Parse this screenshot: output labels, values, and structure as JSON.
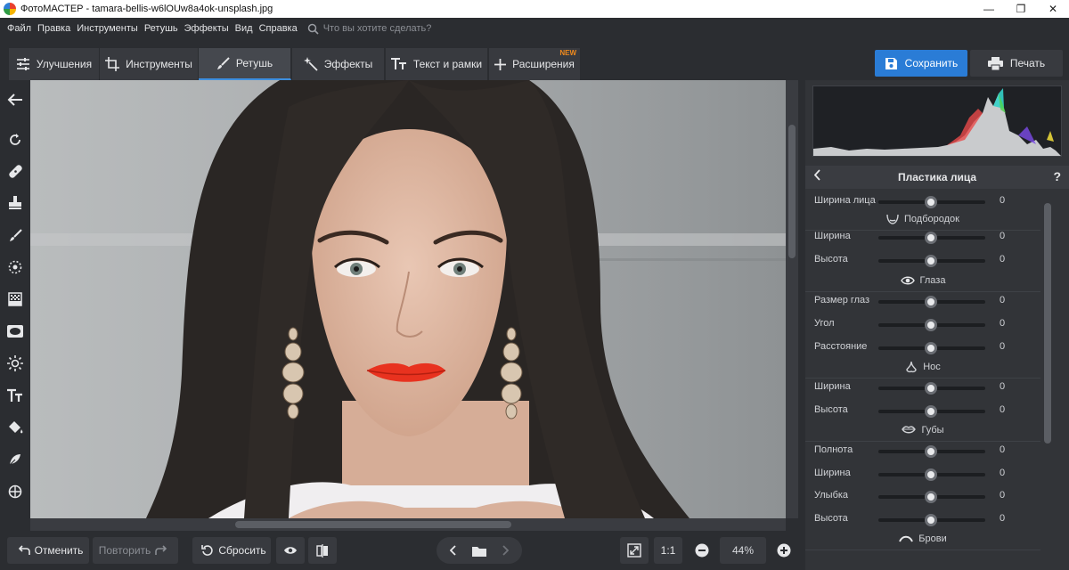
{
  "window": {
    "title": "ФотоМАСТЕР - tamara-bellis-w6lOUw8a4ok-unsplash.jpg",
    "controls": [
      "—",
      "❐",
      "✕"
    ]
  },
  "menu": {
    "items": [
      "Файл",
      "Правка",
      "Инструменты",
      "Ретушь",
      "Эффекты",
      "Вид",
      "Справка"
    ],
    "search_placeholder": "Что вы хотите сделать?"
  },
  "tabs": [
    {
      "label": "Улучшения",
      "icon": "sliders-icon",
      "active": false
    },
    {
      "label": "Инструменты",
      "icon": "crop-icon",
      "active": false
    },
    {
      "label": "Ретушь",
      "icon": "brush-icon",
      "active": true
    },
    {
      "label": "Эффекты",
      "icon": "sparkle-icon",
      "active": false
    },
    {
      "label": "Текст и рамки",
      "icon": "text-icon",
      "active": false
    },
    {
      "label": "Расширения",
      "icon": "plus-icon",
      "active": false,
      "badge": "NEW"
    }
  ],
  "actions": {
    "save": "Сохранить",
    "print": "Печать"
  },
  "colors": {
    "accent": "#2a7cd6",
    "badge": "#f08a1d",
    "lips": "#e8321f"
  },
  "left_tools": [
    "back-arrow-icon",
    "rotate-icon",
    "bandage-icon",
    "stamp-icon",
    "brush-icon",
    "target-icon",
    "gradient-icon",
    "vignette-icon",
    "sun-icon",
    "text-icon",
    "fill-icon",
    "quill-icon",
    "crosshair-icon"
  ],
  "bottom": {
    "undo": "Отменить",
    "redo": "Повторить",
    "reset": "Сбросить",
    "ratio": "1:1",
    "zoom": "44%"
  },
  "panel": {
    "title": "Пластика лица",
    "help": "?",
    "rows": [
      {
        "kind": "slider",
        "label": "Ширина лица",
        "value": "0"
      },
      {
        "kind": "group",
        "label": "Подбородок",
        "icon": "chin-icon"
      },
      {
        "kind": "slider",
        "label": "Ширина",
        "value": "0"
      },
      {
        "kind": "slider",
        "label": "Высота",
        "value": "0"
      },
      {
        "kind": "group",
        "label": "Глаза",
        "icon": "eye-icon"
      },
      {
        "kind": "slider",
        "label": "Размер глаз",
        "value": "0"
      },
      {
        "kind": "slider",
        "label": "Угол",
        "value": "0"
      },
      {
        "kind": "slider",
        "label": "Расстояние",
        "value": "0"
      },
      {
        "kind": "group",
        "label": "Нос",
        "icon": "nose-icon"
      },
      {
        "kind": "slider",
        "label": "Ширина",
        "value": "0"
      },
      {
        "kind": "slider",
        "label": "Высота",
        "value": "0"
      },
      {
        "kind": "group",
        "label": "Губы",
        "icon": "lips-icon"
      },
      {
        "kind": "slider",
        "label": "Полнота",
        "value": "0"
      },
      {
        "kind": "slider",
        "label": "Ширина",
        "value": "0"
      },
      {
        "kind": "slider",
        "label": "Улыбка",
        "value": "0"
      },
      {
        "kind": "slider",
        "label": "Высота",
        "value": "0"
      },
      {
        "kind": "group",
        "label": "Брови",
        "icon": "brow-icon"
      }
    ]
  }
}
